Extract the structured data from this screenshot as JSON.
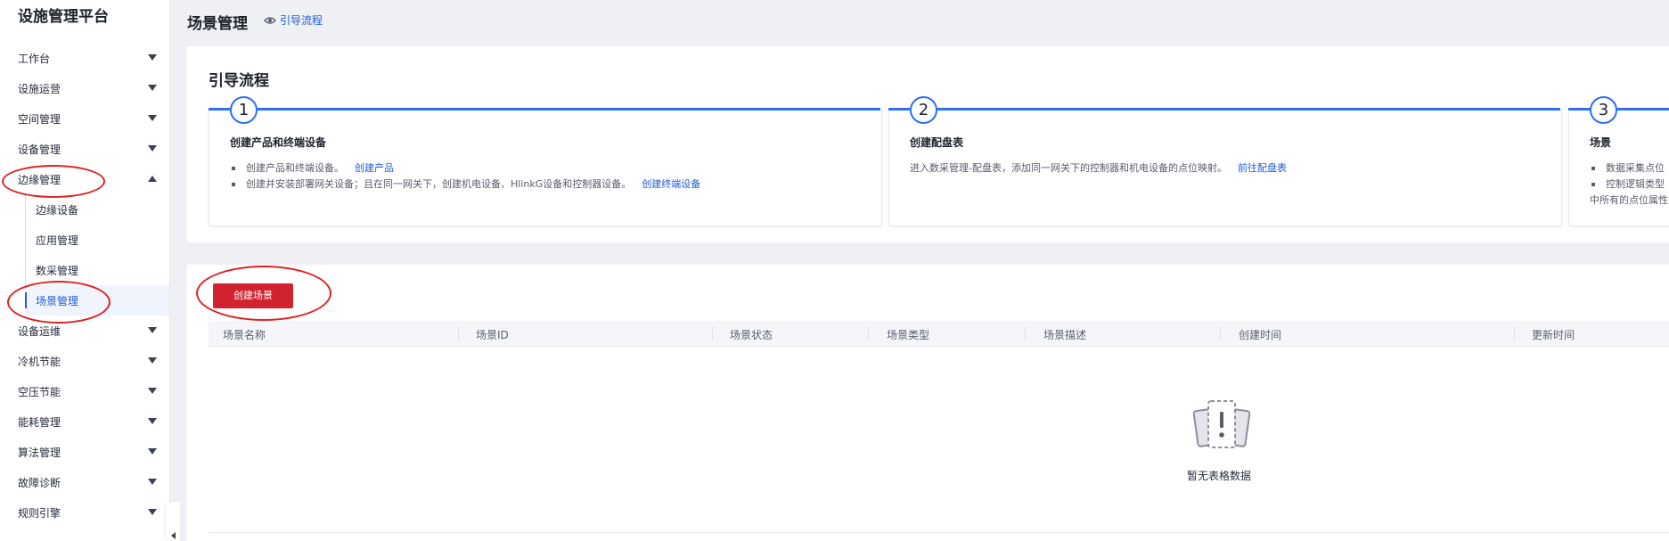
{
  "sidebar": {
    "brand": "设施管理平台",
    "items": [
      {
        "label": "工作台"
      },
      {
        "label": "设施运营"
      },
      {
        "label": "空间管理"
      },
      {
        "label": "设备管理"
      },
      {
        "label": "边缘管理"
      },
      {
        "label": "设备运维"
      },
      {
        "label": "冷机节能"
      },
      {
        "label": "空压节能"
      },
      {
        "label": "能耗管理"
      },
      {
        "label": "算法管理"
      },
      {
        "label": "故障诊断"
      },
      {
        "label": "规则引擎"
      }
    ],
    "sub_items": [
      {
        "label": "边缘设备"
      },
      {
        "label": "应用管理"
      },
      {
        "label": "数采管理"
      },
      {
        "label": "场景管理"
      }
    ]
  },
  "header": {
    "title": "场景管理",
    "guide_link": "引导流程"
  },
  "guide": {
    "title": "引导流程",
    "steps": [
      {
        "number": "1",
        "name": "创建产品和终端设备",
        "line1": "创建产品和终端设备。",
        "line1_link": "创建产品",
        "line2": "创建并安装部署网关设备；且在同一网关下，创建机电设备、HlinkG设备和控制器设备。",
        "line2_link": "创建终端设备"
      },
      {
        "number": "2",
        "name": "创建配盘表",
        "line1": "进入数采管理-配盘表，添加同一网关下的控制器和机电设备的点位映射。",
        "line1_link": "前往配盘表"
      },
      {
        "number": "3",
        "name": "场景",
        "line1": "数据采集点位",
        "line2": "控制逻辑类型",
        "line3": "中所有的点位属性"
      }
    ]
  },
  "list": {
    "create_button": "创建场景",
    "columns": [
      "场景名称",
      "场景ID",
      "场景状态",
      "场景类型",
      "场景描述",
      "创建时间",
      "更新时间"
    ],
    "empty_text": "暂无表格数据"
  },
  "colors": {
    "accent": "#1f5bd6",
    "primary_button": "#d1232f",
    "annotation": "#e02020"
  }
}
